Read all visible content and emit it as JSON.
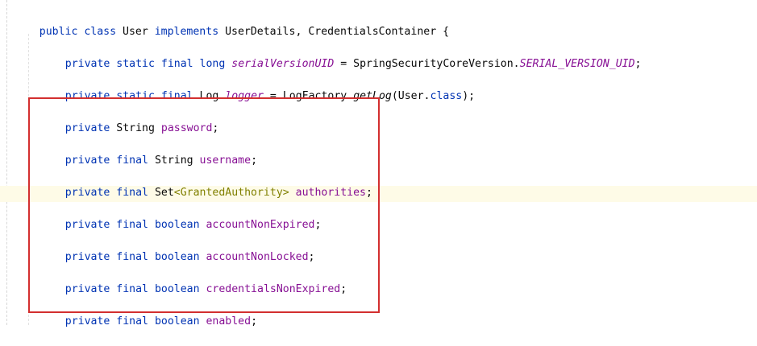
{
  "line1": {
    "kw_public": "public",
    "kw_class": "class",
    "class_name": "User",
    "kw_implements": "implements",
    "iface1": "UserDetails",
    "comma": ",",
    "iface2": "CredentialsContainer",
    "brace": "{"
  },
  "line2": {
    "private": "private",
    "static": "static",
    "final": "final",
    "type": "long",
    "name": "serialVersionUID",
    "eq": "=",
    "qualifier": "SpringSecurityCoreVersion",
    "dot": ".",
    "const": "SERIAL_VERSION_UID",
    "semi": ";"
  },
  "line3": {
    "private": "private",
    "static": "static",
    "final": "final",
    "type": "Log",
    "name": "logger",
    "eq": "=",
    "factory": "LogFactory",
    "dot": ".",
    "method": "getLog",
    "open": "(",
    "arg_class": "User",
    "dot2": ".",
    "kw_class": "class",
    "close": ");"
  },
  "fields": [
    {
      "private": "private",
      "final": "",
      "type_open": "String",
      "type_generic": "",
      "type_close": "",
      "name": "password",
      "semi": ";"
    },
    {
      "private": "private",
      "final": "final",
      "type_open": "String",
      "type_generic": "",
      "type_close": "",
      "name": "username",
      "semi": ";"
    },
    {
      "private": "private",
      "final": "final",
      "type_open": "Set",
      "type_generic": "<GrantedAuthority>",
      "type_close": "",
      "name": "authorities",
      "semi": ";"
    },
    {
      "private": "private",
      "final": "final",
      "type_open": "boolean",
      "type_generic": "",
      "type_close": "",
      "name": "accountNonExpired",
      "semi": ";"
    },
    {
      "private": "private",
      "final": "final",
      "type_open": "boolean",
      "type_generic": "",
      "type_close": "",
      "name": "accountNonLocked",
      "semi": ";"
    },
    {
      "private": "private",
      "final": "final",
      "type_open": "boolean",
      "type_generic": "",
      "type_close": "",
      "name": "credentialsNonExpired",
      "semi": ";"
    },
    {
      "private": "private",
      "final": "final",
      "type_open": "boolean",
      "type_generic": "",
      "type_close": "",
      "name": "enabled",
      "semi": ";"
    }
  ],
  "colors": {
    "keyword": "#0033b3",
    "field": "#871094",
    "generic": "#808000",
    "highlight_box": "#d32f2f",
    "current_line": "#fefbe7"
  }
}
